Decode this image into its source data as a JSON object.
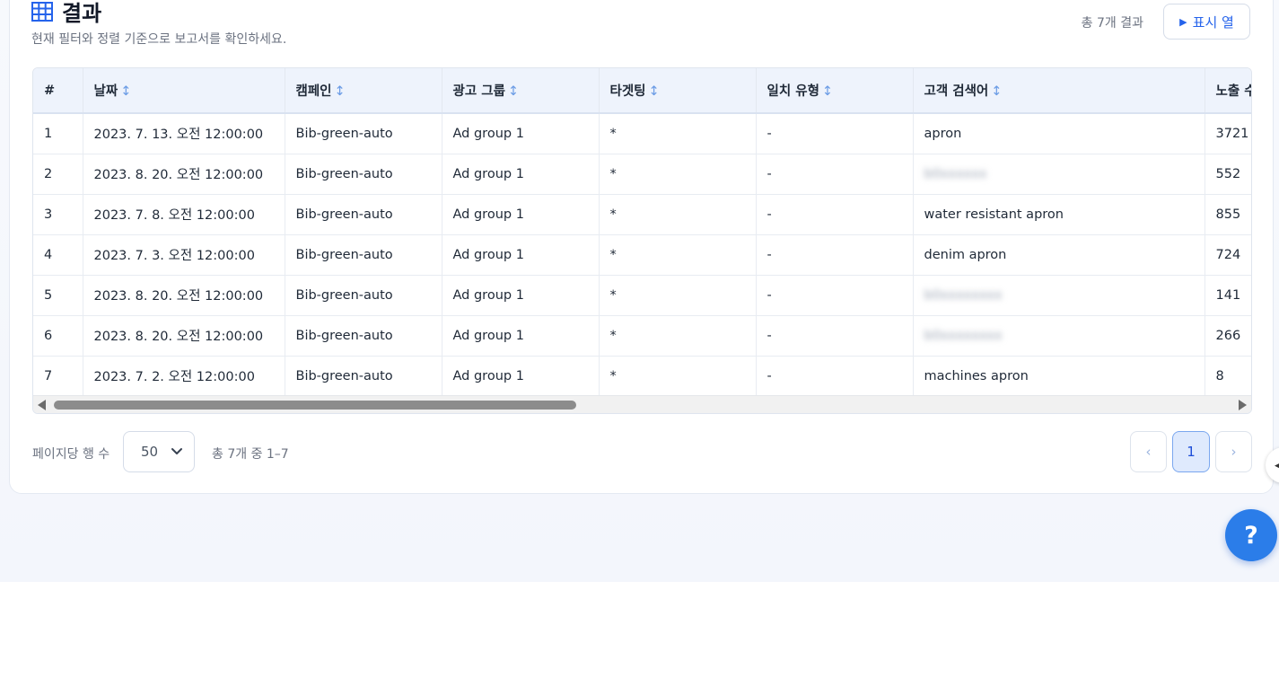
{
  "header": {
    "title": "결과",
    "subtitle": "현재 필터와 정렬 기준으로 보고서를 확인하세요.",
    "total_count": "총 7개 결과",
    "columns_button": "표시 열"
  },
  "table": {
    "columns": [
      {
        "label": "#",
        "sortable": false
      },
      {
        "label": "날짜",
        "sortable": true
      },
      {
        "label": "캠페인",
        "sortable": true
      },
      {
        "label": "광고 그룹",
        "sortable": true
      },
      {
        "label": "타겟팅",
        "sortable": true
      },
      {
        "label": "일치 유형",
        "sortable": true
      },
      {
        "label": "고객 검색어",
        "sortable": true
      },
      {
        "label": "노출 수",
        "sortable": true
      }
    ],
    "sort_glyph": "↕",
    "rows": [
      {
        "num": "1",
        "date": "2023. 7. 13. 오전 12:00:00",
        "campaign": "Bib-green-auto",
        "ad_group": "Ad group 1",
        "targeting": "*",
        "match_type": "-",
        "search_term": "apron",
        "blurred": false,
        "impressions": "3721"
      },
      {
        "num": "2",
        "date": "2023. 8. 20. 오전 12:00:00",
        "campaign": "Bib-green-auto",
        "ad_group": "Ad group 1",
        "targeting": "*",
        "match_type": "-",
        "search_term": "b0xxxxxx",
        "blurred": true,
        "impressions": "552"
      },
      {
        "num": "3",
        "date": "2023. 7. 8. 오전 12:00:00",
        "campaign": "Bib-green-auto",
        "ad_group": "Ad group 1",
        "targeting": "*",
        "match_type": "-",
        "search_term": "water resistant apron",
        "blurred": false,
        "impressions": "855"
      },
      {
        "num": "4",
        "date": "2023. 7. 3. 오전 12:00:00",
        "campaign": "Bib-green-auto",
        "ad_group": "Ad group 1",
        "targeting": "*",
        "match_type": "-",
        "search_term": "denim apron",
        "blurred": false,
        "impressions": "724"
      },
      {
        "num": "5",
        "date": "2023. 8. 20. 오전 12:00:00",
        "campaign": "Bib-green-auto",
        "ad_group": "Ad group 1",
        "targeting": "*",
        "match_type": "-",
        "search_term": "b0xxxxxxxx",
        "blurred": true,
        "impressions": "141"
      },
      {
        "num": "6",
        "date": "2023. 8. 20. 오전 12:00:00",
        "campaign": "Bib-green-auto",
        "ad_group": "Ad group 1",
        "targeting": "*",
        "match_type": "-",
        "search_term": "b0xxxxxxxx",
        "blurred": true,
        "impressions": "266"
      },
      {
        "num": "7",
        "date": "2023. 7. 2. 오전 12:00:00",
        "campaign": "Bib-green-auto",
        "ad_group": "Ad group 1",
        "targeting": "*",
        "match_type": "-",
        "search_term": "machines apron",
        "blurred": false,
        "impressions": "8"
      }
    ]
  },
  "pagination": {
    "rows_per_page_label": "페이지당 행 수",
    "rows_per_page_value": "50",
    "range_text": "총 7개 중 1–7",
    "prev": "‹",
    "current_page": "1",
    "next": "›"
  },
  "floating": {
    "help_label": "?",
    "side_tab_glyph": "◀"
  },
  "icons": {
    "title_icon": "table-grid-icon",
    "columns_icon": "play-triangle-icon",
    "select_icon": "chevron-down-icon"
  },
  "colors": {
    "accent": "#2563eb",
    "header_bg": "#eef3fc",
    "help_button": "#2b7de9"
  }
}
